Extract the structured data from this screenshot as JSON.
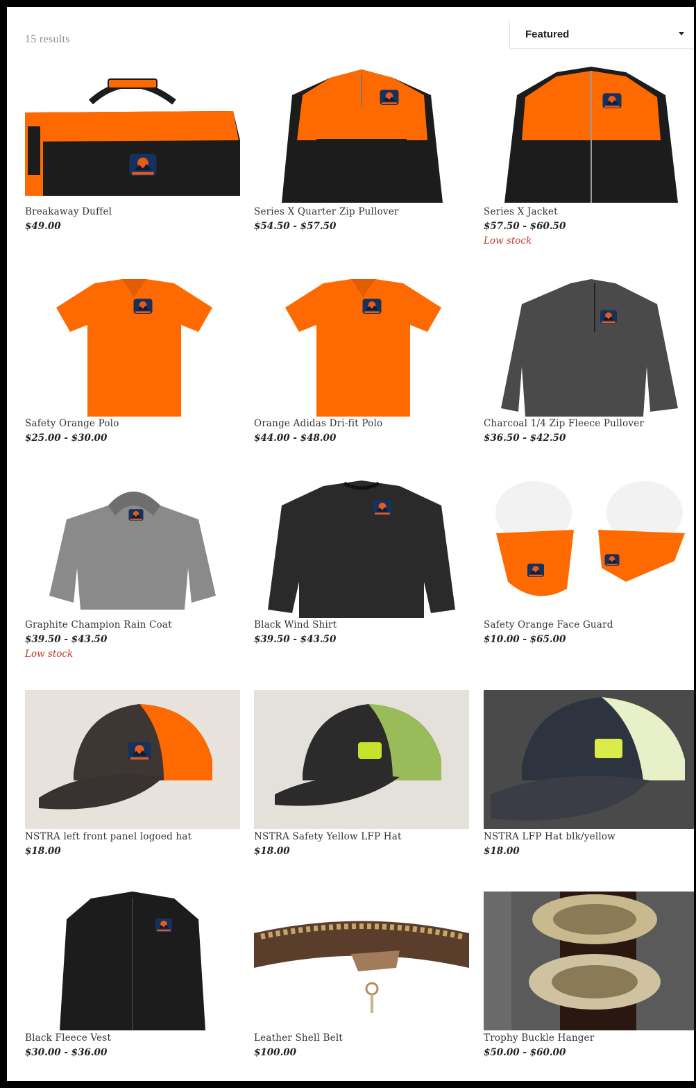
{
  "results_count": "15 results",
  "sort": {
    "selected": "Featured"
  },
  "colors": {
    "orange": "#ff6a00",
    "black": "#1c1c1c",
    "low_stock": "#c0392b"
  },
  "products": [
    {
      "title": "Breakaway Duffel",
      "price": "$49.00",
      "stock": "",
      "image": "duffel-bag"
    },
    {
      "title": "Series X Quarter Zip Pullover",
      "price": "$54.50 - $57.50",
      "stock": "",
      "image": "quarter-zip-pullover"
    },
    {
      "title": "Series X Jacket",
      "price": "$57.50 - $60.50",
      "stock": "Low stock",
      "image": "jacket"
    },
    {
      "title": "Safety Orange Polo",
      "price": "$25.00 - $30.00",
      "stock": "",
      "image": "orange-polo"
    },
    {
      "title": "Orange Adidas Dri-fit Polo",
      "price": "$44.00 - $48.00",
      "stock": "",
      "image": "orange-polo"
    },
    {
      "title": "Charcoal 1/4 Zip Fleece Pullover",
      "price": "$36.50 - $42.50",
      "stock": "",
      "image": "charcoal-pullover"
    },
    {
      "title": "Graphite Champion Rain Coat",
      "price": "$39.50 - $43.50",
      "stock": "Low stock",
      "image": "rain-coat"
    },
    {
      "title": "Black Wind Shirt",
      "price": "$39.50 - $43.50",
      "stock": "",
      "image": "wind-shirt"
    },
    {
      "title": "Safety Orange Face Guard",
      "price": "$10.00 - $65.00",
      "stock": "",
      "image": "face-guard"
    },
    {
      "title": "NSTRA left front panel logoed hat",
      "price": "$18.00",
      "stock": "",
      "image": "hat-orange"
    },
    {
      "title": "NSTRA Safety Yellow LFP Hat",
      "price": "$18.00",
      "stock": "",
      "image": "hat-yellow"
    },
    {
      "title": "NSTRA LFP Hat blk/yellow",
      "price": "$18.00",
      "stock": "",
      "image": "hat-blk-yellow"
    },
    {
      "title": "Black Fleece Vest",
      "price": "$30.00 - $36.00",
      "stock": "",
      "image": "fleece-vest"
    },
    {
      "title": "Leather Shell Belt",
      "price": "$100.00",
      "stock": "",
      "image": "shell-belt"
    },
    {
      "title": "Trophy Buckle Hanger",
      "price": "$50.00 - $60.00",
      "stock": "",
      "image": "buckle-hanger"
    }
  ]
}
